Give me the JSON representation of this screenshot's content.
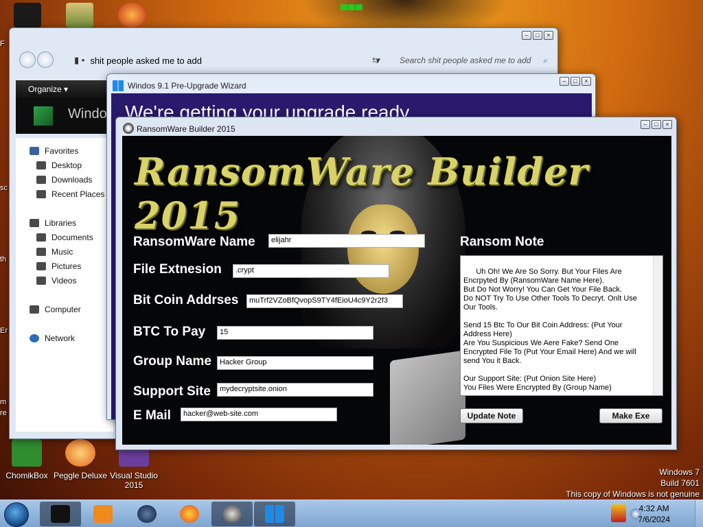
{
  "desktop": {
    "icons": [
      {
        "label": "ChomikBox",
        "color": "#2f8c2f"
      },
      {
        "label": "Peggle Deluxe",
        "color": "#e0651a"
      },
      {
        "label": "Visual Studio 2015",
        "color": "#6a3fa0"
      }
    ],
    "watermark": {
      "line1": "Windows 7",
      "line2": "Build 7601",
      "line3": "This copy of Windows is not genuine"
    },
    "edge_fragments": [
      "F",
      "sc",
      "th",
      "Er",
      "m",
      "re"
    ]
  },
  "explorer": {
    "address": "shit people asked me to add",
    "search_placeholder": "Search shit people asked me to add",
    "organize_label": "Organize",
    "banner_text": "Windo",
    "nav": {
      "favorites": "Favorites",
      "desktop": "Desktop",
      "downloads": "Downloads",
      "recent_places": "Recent Places",
      "libraries": "Libraries",
      "documents": "Documents",
      "music": "Music",
      "pictures": "Pictures",
      "videos": "Videos",
      "computer": "Computer",
      "network": "Network"
    }
  },
  "wizard": {
    "title": "Windos 9.1 Pre-Upgrade Wizard",
    "heading": "We're getting your upgrade ready"
  },
  "builder": {
    "title": "RansomWare Builder 2015",
    "logo": "RansomWare Builder 2015",
    "fields": {
      "name_label": "RansomWare Name",
      "name_value": "elijahr",
      "extension_label": "File Extnesion",
      "extension_value": ".crypt",
      "address_label": "Bit Coin Addrses",
      "address_value": "muTrf2VZoBfQvopS9TY4fEioU4c9Y2r2f3",
      "btc_label": "BTC To Pay",
      "btc_value": "15",
      "group_label": "Group Name",
      "group_value": "Hacker Group",
      "site_label": "Support Site",
      "site_value": "mydecryptsite.onion",
      "email_label": "E Mail",
      "email_value": "hacker@web-site.com"
    },
    "note_label": "Ransom Note",
    "note_text": "Uh Oh! We Are So Sorry. But Your Files Are Encrpyted By (RansomWare Name Here).\nBut Do Not Worry! You Can Get Your File Back.\nDo NOT Try To Use Other Tools To Decryt. Onlt Use Our Tools.\n\nSend 15 Btc To Our Bit Coin Address: (Put Your Address Here)\nAre You Suspicious We Aere Fake? Send One Encrypted File To (Put Your Email Here) And we will send You it Back.\n\nOur Support Site: (Put Onion Site Here)\nYou Files Were Encrypted By (Group Name)",
    "update_button": "Update Note",
    "make_button": "Make Exe"
  },
  "taskbar": {
    "time": "4:32 AM",
    "date": "7/6/2024"
  },
  "colors": {
    "logo_gold": "#d9d26a",
    "wizard_purple": "#2a1a6e",
    "taskbar_blue": "#7ea5cf"
  }
}
